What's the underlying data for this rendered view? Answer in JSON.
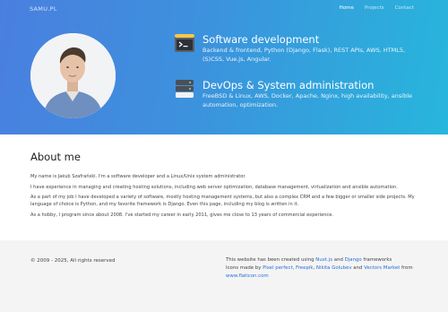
{
  "nav": {
    "brand": "SAMU.PL",
    "links": [
      "Home",
      "Projects",
      "Contact"
    ]
  },
  "hero": {
    "skills": [
      {
        "title": "Software development",
        "desc": "Backend & frontend, Python (Django, Flask), REST APIs, AWS, HTML5, (S)CSS, Vue.js, Angular.",
        "icon": "terminal-icon"
      },
      {
        "title": "DevOps & System administration",
        "desc": "FreeBSD & Linux, AWS, Docker, Apache, Nginx, high availability, ansible automation, optimization.",
        "icon": "server-icon"
      }
    ]
  },
  "about": {
    "heading": "About me",
    "paragraphs": [
      "My name is Jakub Szafrański. I'm a software developer and a Linux/Unix system administrator.",
      "I have experience in managing and creating hosting solutions, including web server optimization, database management, virtualization and ansible automation.",
      "As a part of my job I have developed a variety of software, mostly hosting management systems, but also a complex CRM and a few bigger or smaller side projects. My language of choice is Python, and my favorite framework is Django. Even this page, including my blog is written in it.",
      "As a hobby, I program since about 2008. I've started my career in early 2011, gives me close to 13 years of commercial experience."
    ]
  },
  "footer": {
    "copyright": "© 2009 - 2025, All rights reserved",
    "built_prefix": "This website has been created using ",
    "built_link1": "Nuxt.js",
    "built_and": " and ",
    "built_link2": "Django",
    "built_suffix": " frameworks",
    "icons_prefix": "Icons made by ",
    "icons_link1": "Pixel perfect",
    "icons_sep1": ", ",
    "icons_link2": "Freepik",
    "icons_sep2": ", ",
    "icons_link3": "Nikita Golubev",
    "icons_and": " and ",
    "icons_link4": "Vectors Market",
    "icons_from": " from",
    "icons_site": "www.flaticon.com"
  },
  "colors": {
    "hero_gradient_start": "#4a7fe0",
    "hero_gradient_end": "#27b6dc",
    "link": "#2a6fd6",
    "footer_bg": "#f4f4f4"
  }
}
